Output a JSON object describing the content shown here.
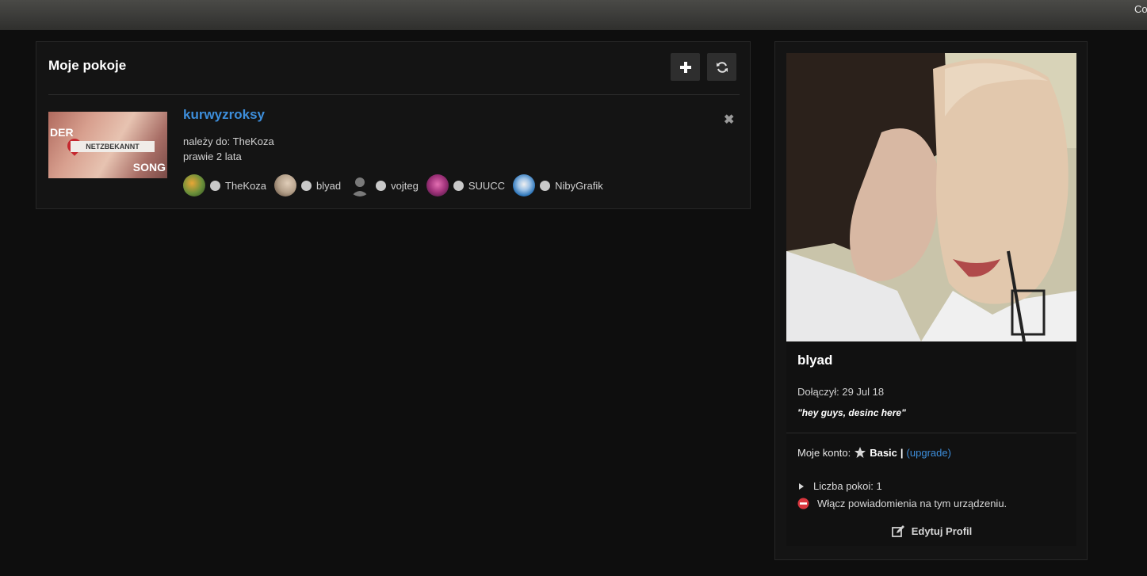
{
  "topbar": {
    "corner_text": "Co"
  },
  "rooms": {
    "title": "Moje pokoje",
    "add_icon": "plus-icon",
    "refresh_icon": "refresh-icon",
    "items": [
      {
        "name": "kurwyzroksy",
        "owner_text": "należy do: TheKoza",
        "age_text": "prawie 2 lata",
        "thumb_text_top": "DER",
        "thumb_text_bottom": "SONG",
        "thumb_band": "NETZBEKANNT",
        "members": [
          {
            "name": "TheKoza",
            "avatar_color": "#6a8f3a"
          },
          {
            "name": "blyad",
            "avatar_color": "#b4a08a"
          },
          {
            "name": "vojteg",
            "avatar_color": "#5a5a5a"
          },
          {
            "name": "SUUCC",
            "avatar_color": "#a0327a"
          },
          {
            "name": "NibyGrafik",
            "avatar_color": "#2b74b8"
          }
        ]
      }
    ]
  },
  "profile": {
    "username": "blyad",
    "joined": "Dołączył: 29 Jul 18",
    "quote": "\"hey guys, desinc here\"",
    "account_label": "Moje konto:",
    "account_tier": "Basic",
    "account_pipe": "|",
    "upgrade_label": "(upgrade)",
    "rooms_count": "Liczba pokoi: 1",
    "notify_label": "Włącz powiadomienia na tym urządzeniu.",
    "edit_label": "Edytuj Profil"
  },
  "colors": {
    "accent_link": "#3d8edb",
    "notify_icon": "#d9363e",
    "status_offline": "#c9c9c9"
  }
}
